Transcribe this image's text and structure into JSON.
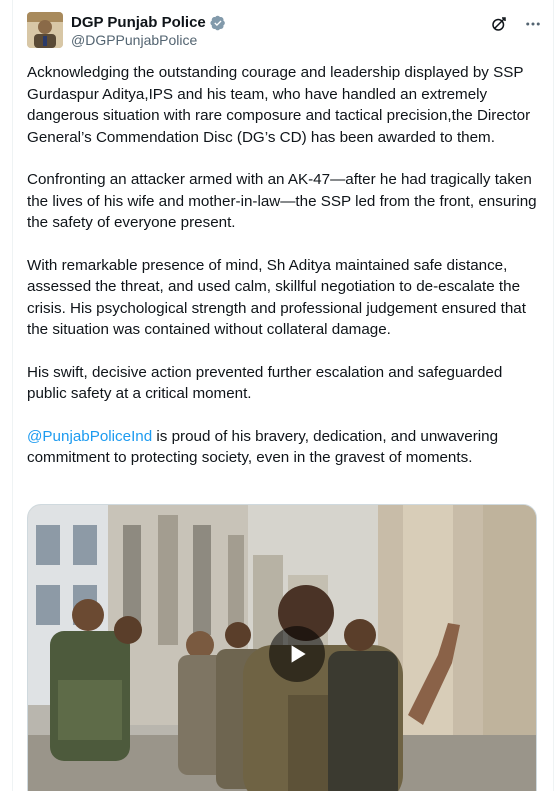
{
  "account": {
    "display_name": "DGP Punjab Police",
    "handle": "@DGPPunjabPolice"
  },
  "tweet": {
    "para1": "Acknowledging the outstanding courage and leadership displayed by SSP Gurdaspur Aditya,IPS and his team, who have handled an extremely dangerous situation with rare composure and tactical precision,the Director General’s Commendation Disc (DG’s CD) has been awarded to them.",
    "para2": "Confronting an attacker armed with an AK-47—after he had tragically taken the lives of his wife and mother-in-law—the SSP led from the front, ensuring the safety of everyone present.",
    "para3": "With remarkable presence of mind, Sh Aditya maintained safe distance, assessed the threat, and used calm, skillful negotiation to de-escalate the crisis. His psychological strength and professional judgement ensured that the situation was contained without collateral damage.",
    "para4": "His swift, decisive action prevented further escalation and safeguarded public safety at a critical moment.",
    "para5_mention": "@PunjabPoliceInd",
    "para5_rest": " is proud of his bravery, dedication, and unwavering commitment to protecting society, even in the gravest of moments."
  },
  "icons": {
    "verified": "verified-badge-icon",
    "grok": "grok-icon",
    "more": "more-icon",
    "play": "play-icon"
  },
  "colors": {
    "accent": "#1d9bf0",
    "text": "#0f1419",
    "secondary": "#536471"
  }
}
